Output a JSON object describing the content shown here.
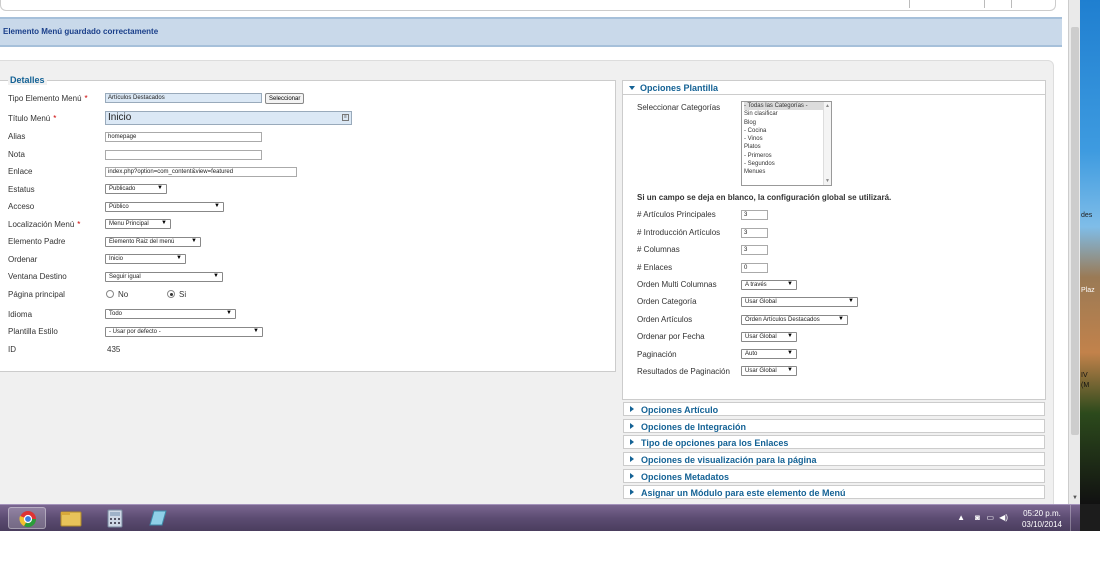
{
  "message": "Elemento Menú guardado correctamente",
  "details": {
    "legend": "Detalles",
    "fields": {
      "tipo_label": "Tipo Elemento Menú",
      "tipo_value": "Artículos Destacados",
      "tipo_button": "Seleccionar",
      "titulo_label": "Título Menú",
      "titulo_value": "Inicio",
      "alias_label": "Alias",
      "alias_value": "homepage",
      "nota_label": "Nota",
      "nota_value": "",
      "enlace_label": "Enlace",
      "enlace_value": "index.php?option=com_content&view=featured",
      "estatus_label": "Estatus",
      "estatus_value": "Publicado",
      "acceso_label": "Acceso",
      "acceso_value": "Público",
      "localizacion_label": "Localización Menú",
      "localizacion_value": "Menu Principal",
      "padre_label": "Elemento Padre",
      "padre_value": "Elemento Raiz del menú",
      "ordenar_label": "Ordenar",
      "ordenar_value": "Inicio",
      "ventana_label": "Ventana Destino",
      "ventana_value": "Seguir igual",
      "pagina_label": "Página principal",
      "pagina_no": "No",
      "pagina_si": "Si",
      "idioma_label": "Idioma",
      "idioma_value": "Todo",
      "plantilla_label": "Plantilla Estilo",
      "plantilla_value": "- Usar por defecto -",
      "id_label": "ID",
      "id_value": "435"
    }
  },
  "plantilla": {
    "title": "Opciones Plantilla",
    "categorias_label": "Seleccionar Categorías",
    "categorias": [
      "- Todas las Categorías -",
      "Sin clasificar",
      "Blog",
      "- Cocina",
      "- Vinos",
      "Platos",
      "- Primeros",
      "- Segundos",
      "Menues"
    ],
    "note": "Si un campo se deja en blanco, la configuración global se utilizará.",
    "rows": {
      "principales_label": "# Artículos Principales",
      "principales_value": "3",
      "intro_label": "# Introducción Artículos",
      "intro_value": "3",
      "columnas_label": "# Columnas",
      "columnas_value": "3",
      "enlaces_label": "# Enlaces",
      "enlaces_value": "0",
      "multi_label": "Orden Multi Columnas",
      "multi_value": "A través",
      "cat_label": "Orden Categoría",
      "cat_value": "Usar Global",
      "art_label": "Orden Artículos",
      "art_value": "Orden Artículos Destacados",
      "fecha_label": "Ordenar por Fecha",
      "fecha_value": "Usar Global",
      "pag_label": "Paginación",
      "pag_value": "Auto",
      "respag_label": "Resultados de Paginación",
      "respag_value": "Usar Global"
    }
  },
  "accordion": [
    "Opciones Artículo",
    "Opciones de Integración",
    "Tipo de opciones para los Enlaces",
    "Opciones de visualización para la página",
    "Opciones Metadatos",
    "Asignar un Módulo para este elemento de Menú"
  ],
  "desktop": {
    "strip_text_1": "des",
    "strip_text_2": "Plaz",
    "strip_text_3": "IV",
    "strip_text_4": "(M"
  },
  "taskbar": {
    "time": "05:20 p.m.",
    "date": "03/10/2014"
  }
}
